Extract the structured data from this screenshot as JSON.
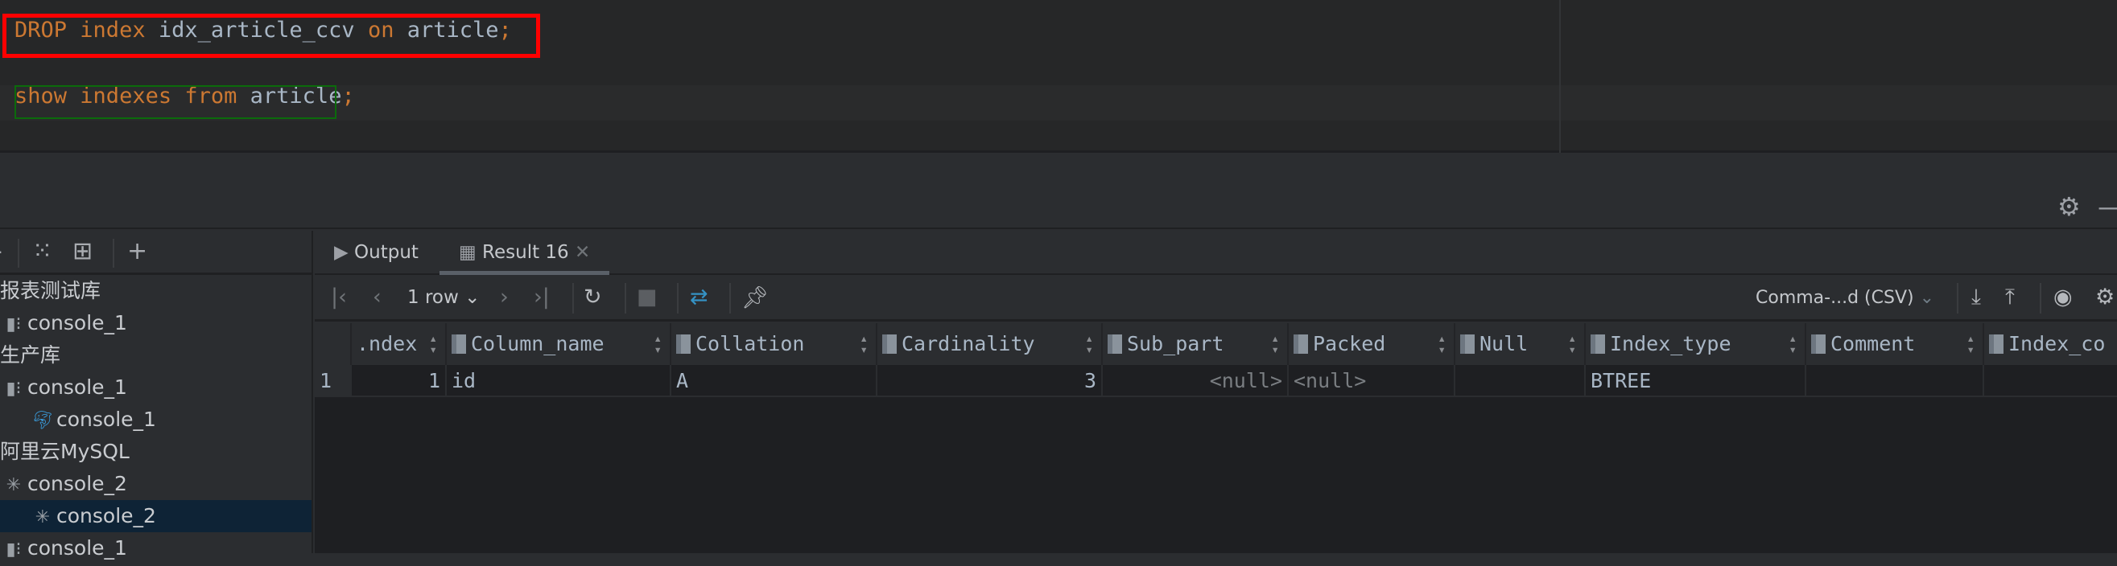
{
  "editor": {
    "line1": [
      {
        "t": "DROP",
        "k": "kw"
      },
      {
        "t": " "
      },
      {
        "t": "index",
        "k": "kw"
      },
      {
        "t": " "
      },
      {
        "t": "idx_article_ccv",
        "k": "id"
      },
      {
        "t": " "
      },
      {
        "t": "on",
        "k": "kw"
      },
      {
        "t": " "
      },
      {
        "t": "article",
        "k": "id"
      },
      {
        "t": ";",
        "k": "kw"
      }
    ],
    "line2": [
      {
        "t": "show",
        "k": "kw"
      },
      {
        "t": " "
      },
      {
        "t": "indexes",
        "k": "kw"
      },
      {
        "t": " "
      },
      {
        "t": "from",
        "k": "kw"
      },
      {
        "t": " "
      },
      {
        "t": "article",
        "k": "id"
      },
      {
        "t": ";",
        "k": "kw"
      }
    ]
  },
  "colors": {
    "keyword": "#cc7832",
    "identifier": "#a9b7c6",
    "highlight_box": "#ff0000",
    "selection": "#0e2336"
  },
  "sidebar": {
    "items": [
      {
        "label": "报表测试库",
        "icon": "",
        "indent": 0
      },
      {
        "label": "console_1",
        "icon": "console-icon",
        "indent": 0
      },
      {
        "label": "生产库",
        "icon": "",
        "indent": 0
      },
      {
        "label": "console_1",
        "icon": "console-icon",
        "indent": 0
      },
      {
        "label": "console_1",
        "icon": "mysql-dolphin-icon",
        "indent": 1
      },
      {
        "label": "阿里云MySQL",
        "icon": "",
        "indent": 0
      },
      {
        "label": "console_2",
        "icon": "loading-icon",
        "indent": 0
      },
      {
        "label": "console_2",
        "icon": "loading-icon",
        "indent": 1,
        "selected": true
      },
      {
        "label": "console_1",
        "icon": "console-icon",
        "indent": 0
      }
    ]
  },
  "tabs": [
    {
      "label": "Output",
      "icon": "output-icon"
    },
    {
      "label": "Result 16",
      "icon": "table-icon",
      "active": true
    }
  ],
  "toolbar": {
    "rows": "1 row",
    "export_format": "Comma-...d (CSV)"
  },
  "grid": {
    "columns": [
      ".ndex",
      "Column_name",
      "Collation",
      "Cardinality",
      "Sub_part",
      "Packed",
      "Null",
      "Index_type",
      "Comment",
      "Index_co"
    ],
    "rows": [
      {
        "num": "1",
        "cells": [
          "1",
          "id",
          "A",
          "3",
          "<null>",
          "<null>",
          "",
          "BTREE",
          "",
          ""
        ]
      }
    ]
  }
}
